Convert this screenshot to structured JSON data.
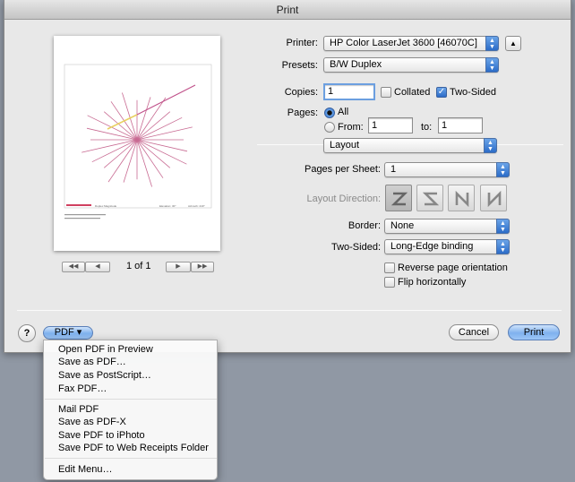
{
  "window": {
    "title": "Print"
  },
  "preview": {
    "page_indicator": "1 of 1",
    "caption_left": "Duplex Magnitude",
    "caption_mid": "Elevation: 30°",
    "caption_right": "Azimuth: 240°"
  },
  "printer": {
    "label": "Printer:",
    "value": "HP Color LaserJet 3600 [46070C]"
  },
  "presets": {
    "label": "Presets:",
    "value": "B/W Duplex"
  },
  "copies": {
    "label": "Copies:",
    "value": "1",
    "collated_label": "Collated",
    "collated_checked": false,
    "two_sided_label": "Two-Sided",
    "two_sided_checked": true
  },
  "pages": {
    "label": "Pages:",
    "all_label": "All",
    "from_label": "From:",
    "from_value": "1",
    "to_label": "to:",
    "to_value": "1",
    "selected": "All"
  },
  "section": {
    "value": "Layout"
  },
  "layout": {
    "pages_per_sheet_label": "Pages per Sheet:",
    "pages_per_sheet_value": "1",
    "direction_label": "Layout Direction:",
    "border_label": "Border:",
    "border_value": "None",
    "two_sided_label": "Two-Sided:",
    "two_sided_value": "Long-Edge binding",
    "reverse_label": "Reverse page orientation",
    "reverse_checked": false,
    "flip_label": "Flip horizontally",
    "flip_checked": false
  },
  "footer": {
    "help_label": "?",
    "pdf_label": "PDF ▾",
    "cancel_label": "Cancel",
    "print_label": "Print"
  },
  "pdf_menu": {
    "group1": [
      "Open PDF in Preview",
      "Save as PDF…",
      "Save as PostScript…",
      "Fax PDF…"
    ],
    "group2": [
      "Mail PDF",
      "Save as PDF-X",
      "Save PDF to iPhoto",
      "Save PDF to Web Receipts Folder"
    ],
    "group3": [
      "Edit Menu…"
    ]
  },
  "colors": {
    "accent": "#3a7ad4",
    "window_bg": "#e8e8e8",
    "desktop_bg": "#9098a4"
  }
}
